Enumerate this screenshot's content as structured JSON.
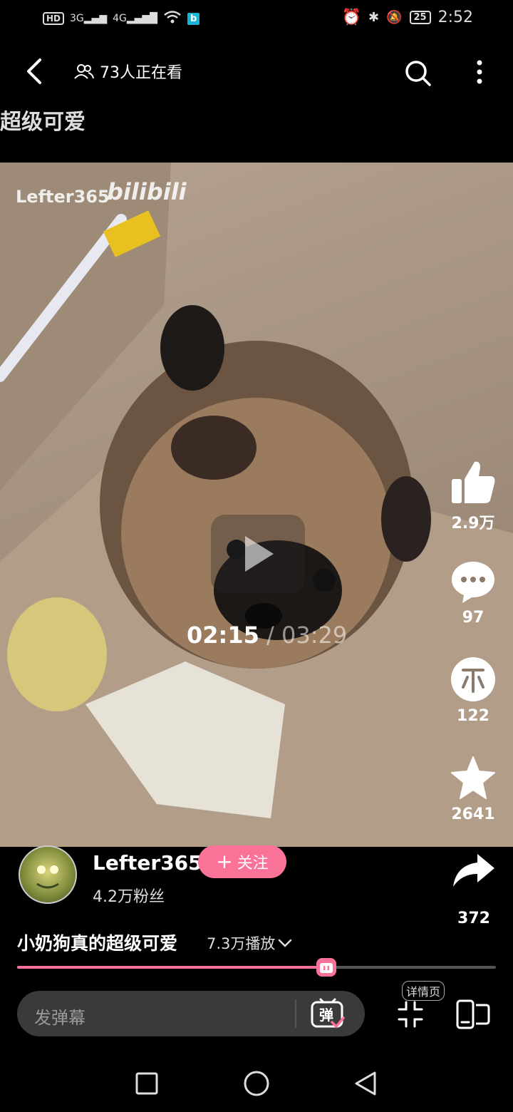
{
  "status_bar": {
    "left_badge": "HD",
    "net1": "3G",
    "net2": "4G",
    "battery": "25",
    "time": "2:52"
  },
  "header": {
    "viewers_text": "73人正在看",
    "page_title": "超级可爱"
  },
  "video": {
    "watermark_user": "Lefter365",
    "watermark_brand": "bilibili",
    "current_time": "02:15",
    "total_time": " / 03:29",
    "progress_fraction": 0.646
  },
  "actions": {
    "likes": "2.9万",
    "comments": "97",
    "coins": "122",
    "favorites": "2641",
    "shares": "372"
  },
  "uploader": {
    "name": "Lefter365",
    "followers": "4.2万粉丝",
    "follow_label": "关注"
  },
  "info": {
    "title": "小奶狗真的超级可爱",
    "play_count": "7.3万播放"
  },
  "bottom_bar": {
    "danmu_placeholder": "发弹幕",
    "danmu_toggle_label": "弹",
    "detail_label": "详情页"
  },
  "colors": {
    "accent": "#fb7299"
  }
}
